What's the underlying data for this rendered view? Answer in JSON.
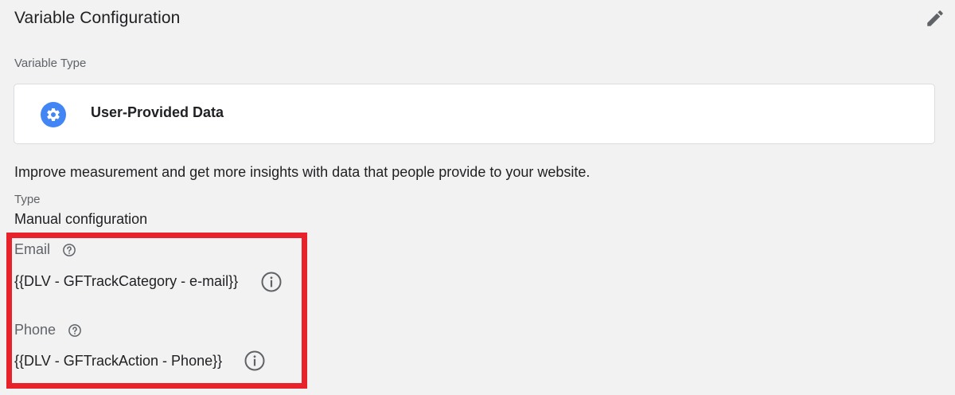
{
  "header": {
    "title": "Variable Configuration",
    "edit_icon": "pencil-icon"
  },
  "variable_type": {
    "label": "Variable Type",
    "name": "User-Provided Data",
    "icon": "gear-icon",
    "icon_color": "#4285f4"
  },
  "description": "Improve measurement and get more insights with data that people provide to your website.",
  "type": {
    "label": "Type",
    "value": "Manual configuration"
  },
  "fields": {
    "email": {
      "label": "Email",
      "value": "{{DLV - GFTrackCategory - e-mail}}"
    },
    "phone": {
      "label": "Phone",
      "value": "{{DLV - GFTrackAction - Phone}}"
    }
  },
  "highlight_color": "#e8222b"
}
